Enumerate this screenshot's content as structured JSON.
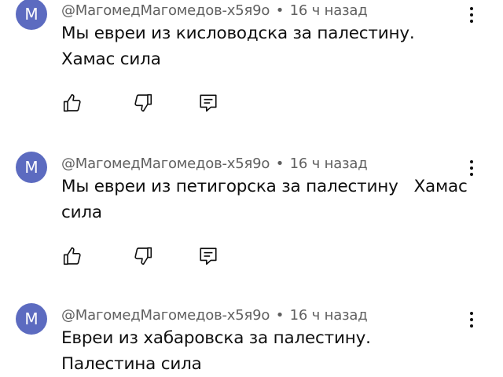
{
  "comments": [
    {
      "avatar_letter": "M",
      "author": "@МагомедМагомедов-х5я9о",
      "separator": "•",
      "time": "16 ч назад",
      "text": "Мы евреи из кисловодска за палестину. Хамас сила"
    },
    {
      "avatar_letter": "M",
      "author": "@МагомедМагомедов-х5я9о",
      "separator": "•",
      "time": "16 ч назад",
      "text": "Мы евреи из петигорска за палестину   Хамас сила"
    },
    {
      "avatar_letter": "M",
      "author": "@МагомедМагомедов-х5я9о",
      "separator": "•",
      "time": "16 ч назад",
      "text": "Евреи из хабаровска за палестину. Палестина сила"
    }
  ],
  "icons": {
    "like": "thumbs-up-icon",
    "dislike": "thumbs-down-icon",
    "reply": "reply-icon",
    "more": "more-vertical-icon"
  },
  "colors": {
    "avatar_bg": "#5c6bc0",
    "meta_text": "#606060",
    "body_text": "#0f0f0f"
  }
}
